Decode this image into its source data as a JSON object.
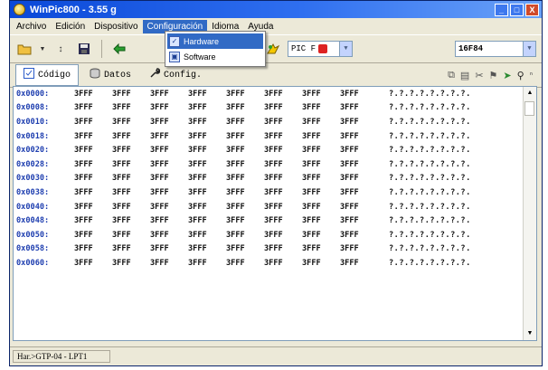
{
  "window": {
    "title": "WinPic800  - 3.55 g",
    "controls": [
      "_",
      "□",
      "X"
    ]
  },
  "menubar": {
    "items": [
      "Archivo",
      "Edición",
      "Dispositivo",
      "Configuración",
      "Idioma",
      "Ayuda"
    ],
    "active_index": 3
  },
  "dropdown": {
    "items": [
      "Hardware",
      "Software"
    ],
    "highlighted_index": 0
  },
  "toolbar": {
    "device_family": "PIC F",
    "device_model": "16F84"
  },
  "tabs": {
    "items": [
      "Código",
      "Datos",
      "Config."
    ],
    "active_index": 0
  },
  "hex": {
    "rows": [
      {
        "addr": "0x0000:",
        "words": [
          "3FFF",
          "3FFF",
          "3FFF",
          "3FFF",
          "3FFF",
          "3FFF",
          "3FFF",
          "3FFF"
        ],
        "ascii": "?.?.?.?.?.?.?.?."
      },
      {
        "addr": "0x0008:",
        "words": [
          "3FFF",
          "3FFF",
          "3FFF",
          "3FFF",
          "3FFF",
          "3FFF",
          "3FFF",
          "3FFF"
        ],
        "ascii": "?.?.?.?.?.?.?.?."
      },
      {
        "addr": "0x0010:",
        "words": [
          "3FFF",
          "3FFF",
          "3FFF",
          "3FFF",
          "3FFF",
          "3FFF",
          "3FFF",
          "3FFF"
        ],
        "ascii": "?.?.?.?.?.?.?.?."
      },
      {
        "addr": "0x0018:",
        "words": [
          "3FFF",
          "3FFF",
          "3FFF",
          "3FFF",
          "3FFF",
          "3FFF",
          "3FFF",
          "3FFF"
        ],
        "ascii": "?.?.?.?.?.?.?.?."
      },
      {
        "addr": "0x0020:",
        "words": [
          "3FFF",
          "3FFF",
          "3FFF",
          "3FFF",
          "3FFF",
          "3FFF",
          "3FFF",
          "3FFF"
        ],
        "ascii": "?.?.?.?.?.?.?.?."
      },
      {
        "addr": "0x0028:",
        "words": [
          "3FFF",
          "3FFF",
          "3FFF",
          "3FFF",
          "3FFF",
          "3FFF",
          "3FFF",
          "3FFF"
        ],
        "ascii": "?.?.?.?.?.?.?.?."
      },
      {
        "addr": "0x0030:",
        "words": [
          "3FFF",
          "3FFF",
          "3FFF",
          "3FFF",
          "3FFF",
          "3FFF",
          "3FFF",
          "3FFF"
        ],
        "ascii": "?.?.?.?.?.?.?.?."
      },
      {
        "addr": "0x0038:",
        "words": [
          "3FFF",
          "3FFF",
          "3FFF",
          "3FFF",
          "3FFF",
          "3FFF",
          "3FFF",
          "3FFF"
        ],
        "ascii": "?.?.?.?.?.?.?.?."
      },
      {
        "addr": "0x0040:",
        "words": [
          "3FFF",
          "3FFF",
          "3FFF",
          "3FFF",
          "3FFF",
          "3FFF",
          "3FFF",
          "3FFF"
        ],
        "ascii": "?.?.?.?.?.?.?.?."
      },
      {
        "addr": "0x0048:",
        "words": [
          "3FFF",
          "3FFF",
          "3FFF",
          "3FFF",
          "3FFF",
          "3FFF",
          "3FFF",
          "3FFF"
        ],
        "ascii": "?.?.?.?.?.?.?.?."
      },
      {
        "addr": "0x0050:",
        "words": [
          "3FFF",
          "3FFF",
          "3FFF",
          "3FFF",
          "3FFF",
          "3FFF",
          "3FFF",
          "3FFF"
        ],
        "ascii": "?.?.?.?.?.?.?.?."
      },
      {
        "addr": "0x0058:",
        "words": [
          "3FFF",
          "3FFF",
          "3FFF",
          "3FFF",
          "3FFF",
          "3FFF",
          "3FFF",
          "3FFF"
        ],
        "ascii": "?.?.?.?.?.?.?.?."
      },
      {
        "addr": "0x0060:",
        "words": [
          "3FFF",
          "3FFF",
          "3FFF",
          "3FFF",
          "3FFF",
          "3FFF",
          "3FFF",
          "3FFF"
        ],
        "ascii": "?.?.?.?.?.?.?.?."
      }
    ]
  },
  "status": {
    "hardware": "Har.>GTP-04 - LPT1"
  },
  "colors": {
    "title_bar": "#0a48d8",
    "selection": "#316ac5",
    "address_text": "#1f3fb0",
    "face": "#ece9d8"
  }
}
